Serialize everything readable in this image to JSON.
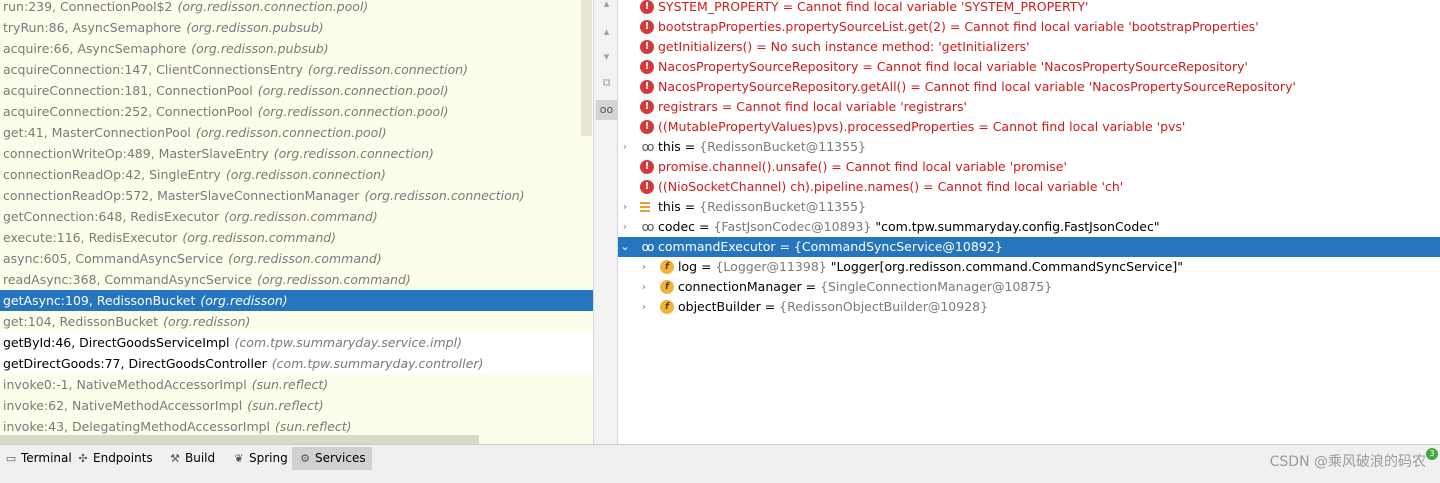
{
  "frames": [
    {
      "method": "run:239, ConnectionPool$2",
      "pkg": "(org.redisson.connection.pool)",
      "state": "lib"
    },
    {
      "method": "tryRun:86, AsyncSemaphore",
      "pkg": "(org.redisson.pubsub)",
      "state": "lib"
    },
    {
      "method": "acquire:66, AsyncSemaphore",
      "pkg": "(org.redisson.pubsub)",
      "state": "lib"
    },
    {
      "method": "acquireConnection:147, ClientConnectionsEntry",
      "pkg": "(org.redisson.connection)",
      "state": "lib"
    },
    {
      "method": "acquireConnection:181, ConnectionPool",
      "pkg": "(org.redisson.connection.pool)",
      "state": "lib"
    },
    {
      "method": "acquireConnection:252, ConnectionPool",
      "pkg": "(org.redisson.connection.pool)",
      "state": "lib"
    },
    {
      "method": "get:41, MasterConnectionPool",
      "pkg": "(org.redisson.connection.pool)",
      "state": "lib"
    },
    {
      "method": "connectionWriteOp:489, MasterSlaveEntry",
      "pkg": "(org.redisson.connection)",
      "state": "lib"
    },
    {
      "method": "connectionReadOp:42, SingleEntry",
      "pkg": "(org.redisson.connection)",
      "state": "lib"
    },
    {
      "method": "connectionReadOp:572, MasterSlaveConnectionManager",
      "pkg": "(org.redisson.connection)",
      "state": "lib"
    },
    {
      "method": "getConnection:648, RedisExecutor",
      "pkg": "(org.redisson.command)",
      "state": "lib"
    },
    {
      "method": "execute:116, RedisExecutor",
      "pkg": "(org.redisson.command)",
      "state": "lib"
    },
    {
      "method": "async:605, CommandAsyncService",
      "pkg": "(org.redisson.command)",
      "state": "lib"
    },
    {
      "method": "readAsync:368, CommandAsyncService",
      "pkg": "(org.redisson.command)",
      "state": "lib"
    },
    {
      "method": "getAsync:109, RedissonBucket",
      "pkg": "(org.redisson)",
      "state": "selected"
    },
    {
      "method": "get:104, RedissonBucket",
      "pkg": "(org.redisson)",
      "state": "lib"
    },
    {
      "method": "getById:46, DirectGoodsServiceImpl",
      "pkg": "(com.tpw.summaryday.service.impl)",
      "state": "user"
    },
    {
      "method": "getDirectGoods:77, DirectGoodsController",
      "pkg": "(com.tpw.summaryday.controller)",
      "state": "user"
    },
    {
      "method": "invoke0:-1, NativeMethodAccessorImpl",
      "pkg": "(sun.reflect)",
      "state": "lib"
    },
    {
      "method": "invoke:62, NativeMethodAccessorImpl",
      "pkg": "(sun.reflect)",
      "state": "lib"
    },
    {
      "method": "invoke:43, DelegatingMethodAccessorImpl",
      "pkg": "(sun.reflect)",
      "state": "lib"
    }
  ],
  "gutter": [
    "▴",
    "▴",
    "▾",
    "⧉",
    "oo"
  ],
  "variables": [
    {
      "kind": "error",
      "text": "SYSTEM_PROPERTY = Cannot find local variable 'SYSTEM_PROPERTY'",
      "expr": "",
      "msg": ""
    },
    {
      "kind": "error",
      "expr": "bootstrapProperties.propertySourceList.get(2) = ",
      "msg": "Cannot find local variable 'bootstrapProperties'"
    },
    {
      "kind": "error",
      "expr": "getInitializers() = ",
      "msg": "No such instance method: 'getInitializers'"
    },
    {
      "kind": "error",
      "expr": "NacosPropertySourceRepository = ",
      "msg": "Cannot find local variable 'NacosPropertySourceRepository'"
    },
    {
      "kind": "error",
      "expr": "NacosPropertySourceRepository.getAll() = ",
      "msg": "Cannot find local variable 'NacosPropertySourceRepository'"
    },
    {
      "kind": "error",
      "expr": "registrars = ",
      "msg": "Cannot find local variable 'registrars'"
    },
    {
      "kind": "error",
      "expr": "((MutablePropertyValues)pvs).processedProperties = ",
      "msg": "Cannot find local variable 'pvs'"
    },
    {
      "kind": "watch",
      "expr": "this = ",
      "ref": "{RedissonBucket@11355}",
      "str": ""
    },
    {
      "kind": "error",
      "expr": "promise.channel().unsafe() = ",
      "msg": "Cannot find local variable 'promise'"
    },
    {
      "kind": "error",
      "expr": "((NioSocketChannel) ch).pipeline.names() = ",
      "msg": "Cannot find local variable 'ch'"
    },
    {
      "kind": "list",
      "expr": "this = ",
      "ref": "{RedissonBucket@11355}",
      "str": ""
    },
    {
      "kind": "watch",
      "expr": "codec = ",
      "ref": "{FastJsonCodec@10893}",
      "str": " \"com.tpw.summaryday.config.FastJsonCodec\""
    },
    {
      "kind": "watch",
      "expr": "commandExecutor = ",
      "ref": "{CommandSyncService@10892}",
      "str": "",
      "selected": true,
      "expanded": true
    },
    {
      "kind": "field",
      "expr": "log = ",
      "ref": "{Logger@11398}",
      "str": " \"Logger[org.redisson.command.CommandSyncService]\""
    },
    {
      "kind": "field",
      "expr": "connectionManager = ",
      "ref": "{SingleConnectionManager@10875}",
      "str": ""
    },
    {
      "kind": "field",
      "expr": "objectBuilder = ",
      "ref": "{RedissonObjectBuilder@10928}",
      "str": ""
    }
  ],
  "toolwindows": [
    {
      "label": "Terminal",
      "icon": "▭"
    },
    {
      "label": "Endpoints",
      "icon": "✣"
    },
    {
      "label": "Build",
      "icon": "⚒"
    },
    {
      "label": "Spring",
      "icon": "❦"
    },
    {
      "label": "Services",
      "icon": "⚙",
      "active": true
    }
  ],
  "watermark": "CSDN @乘风破浪的码农",
  "badge": "3",
  "colors": {
    "selection": "#2675bf",
    "error": "#d01b1b",
    "frames_bg": "#fdfdeb"
  }
}
